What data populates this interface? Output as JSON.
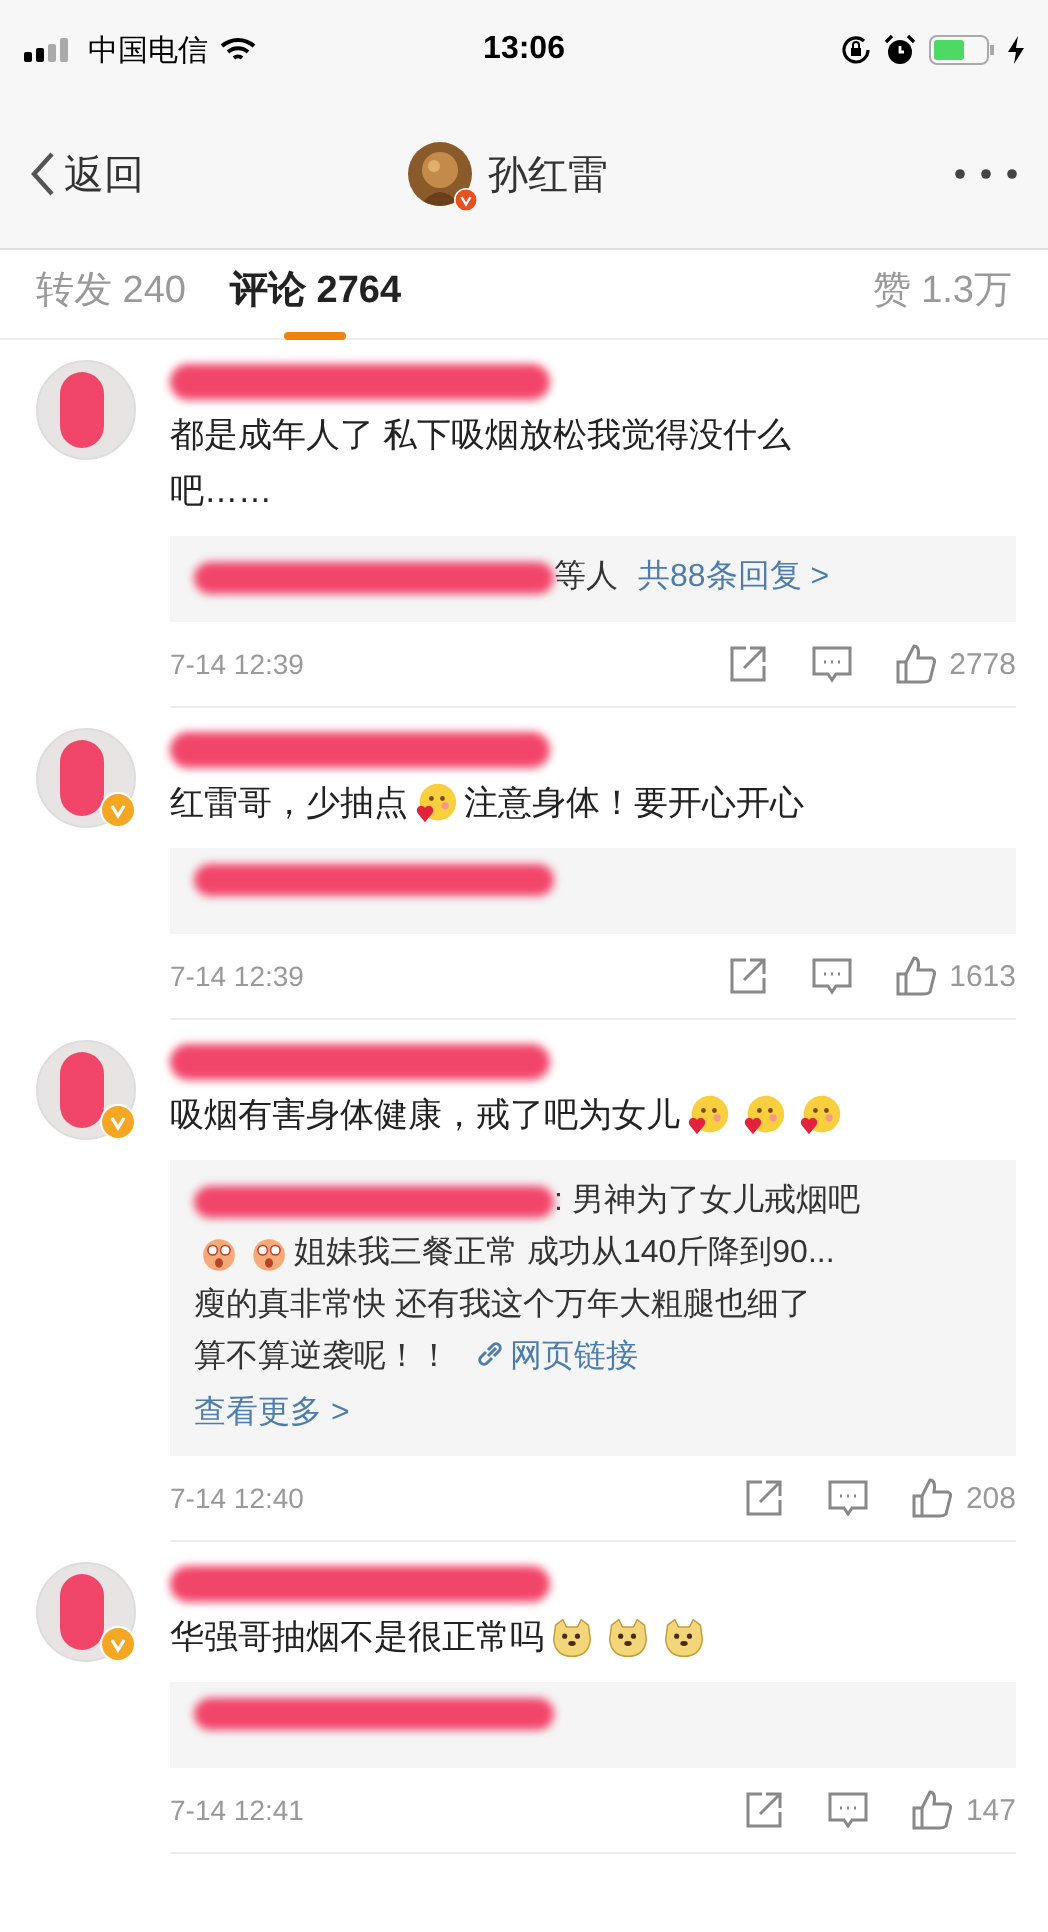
{
  "status_bar": {
    "carrier": "中国电信",
    "time": "13:06"
  },
  "nav": {
    "back": "返回",
    "title": "孙红雷",
    "verified": true
  },
  "tabs": [
    {
      "label": "转发 240",
      "selected": false
    },
    {
      "label": "评论 2764",
      "selected": true
    },
    {
      "label": "赞 1.3万",
      "selected": false
    }
  ],
  "comments": [
    {
      "verified": false,
      "lines": [
        [
          {
            "kind": "text",
            "text": "都是成年人了 私下吸烟放松我觉得没什么"
          }
        ],
        [
          {
            "kind": "text",
            "text": "吧……"
          }
        ]
      ],
      "reply": {
        "lines": [
          [
            {
              "kind": "redaction"
            },
            {
              "kind": "text",
              "text": "等人"
            },
            {
              "kind": "link",
              "text": "共88条回复 >"
            }
          ]
        ]
      },
      "time": "7-14 12:39",
      "likes": "2778"
    },
    {
      "verified": true,
      "lines": [
        [
          {
            "kind": "text",
            "text": "红雷哥，少抽点"
          },
          {
            "kind": "heart-face"
          },
          {
            "kind": "text",
            "text": "注意身体！要开心开心"
          }
        ]
      ],
      "reply": {
        "lines": [
          [
            {
              "kind": "redaction"
            }
          ]
        ]
      },
      "time": "7-14 12:39",
      "likes": "1613"
    },
    {
      "verified": true,
      "lines": [
        [
          {
            "kind": "text",
            "text": "吸烟有害身体健康，戒了吧为女儿"
          },
          {
            "kind": "heart-face"
          },
          {
            "kind": "heart-face"
          },
          {
            "kind": "heart-face"
          }
        ]
      ],
      "reply": {
        "lines": [
          [
            {
              "kind": "redaction"
            },
            {
              "kind": "text",
              "text": ": 男神为了女儿戒烟吧"
            }
          ],
          [
            {
              "kind": "shocked-face"
            },
            {
              "kind": "shocked-face"
            },
            {
              "kind": "text",
              "text": "姐妹我三餐正常 成功从140斤降到90..."
            }
          ],
          [
            {
              "kind": "text",
              "text": "瘦的真非常快  还有我这个万年大粗腿也细了"
            }
          ],
          [
            {
              "kind": "text",
              "text": "算不算逆袭呢！！"
            },
            {
              "kind": "web-link",
              "text": "网页链接"
            }
          ]
        ],
        "more": "查看更多 >"
      },
      "time": "7-14 12:40",
      "likes": "208"
    },
    {
      "verified": true,
      "lines": [
        [
          {
            "kind": "text",
            "text": "华强哥抽烟不是很正常吗"
          },
          {
            "kind": "dog-face"
          },
          {
            "kind": "dog-face"
          },
          {
            "kind": "dog-face"
          }
        ]
      ],
      "reply": {
        "lines": [
          [
            {
              "kind": "redaction"
            }
          ]
        ]
      },
      "time": "7-14 12:41",
      "likes": "147"
    }
  ]
}
